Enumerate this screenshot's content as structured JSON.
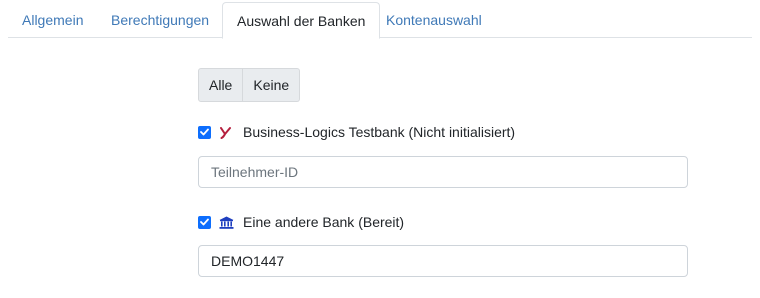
{
  "tabs": [
    {
      "label": "Allgemein",
      "active": false
    },
    {
      "label": "Berechtigungen",
      "active": false
    },
    {
      "label": "Auswahl der Banken",
      "active": true
    },
    {
      "label": "Kontenauswahl",
      "active": false
    }
  ],
  "buttons": {
    "all": "Alle",
    "none": "Keine"
  },
  "banks": [
    {
      "checked": true,
      "icon": "yodlee-y-icon",
      "label": "Business-Logics Testbank (Nicht initialisiert)",
      "field_value": "",
      "field_placeholder": "Teilnehmer-ID"
    },
    {
      "checked": true,
      "icon": "bank-building-icon",
      "label": "Eine andere Bank (Bereit)",
      "field_value": "DEMO1447",
      "field_placeholder": ""
    }
  ],
  "colors": {
    "link": "#3f79b7",
    "checkbox": "#0d6efd",
    "y_icon": "#b51f3d",
    "bank_icon": "#1f3fbf"
  }
}
